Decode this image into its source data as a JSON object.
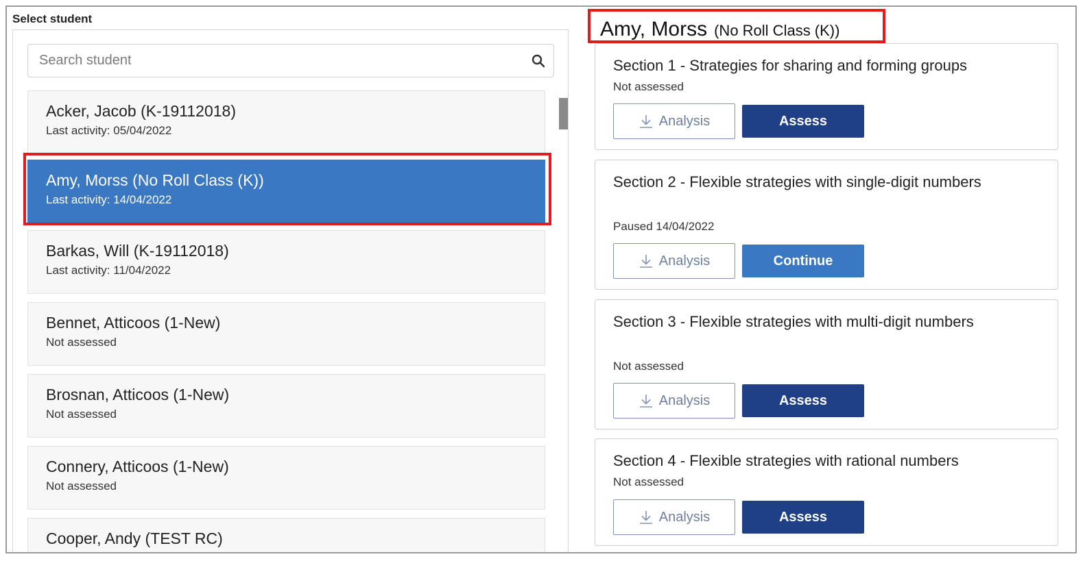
{
  "left_panel": {
    "label": "Select student",
    "search": {
      "placeholder": "Search student",
      "value": ""
    },
    "students": [
      {
        "name": "Acker, Jacob (K-19112018)",
        "sub": "Last activity: 05/04/2022",
        "selected": false
      },
      {
        "name": "Amy, Morss (No Roll Class (K))",
        "sub": "Last activity: 14/04/2022",
        "selected": true
      },
      {
        "name": "Barkas, Will (K-19112018)",
        "sub": "Last activity: 11/04/2022",
        "selected": false
      },
      {
        "name": "Bennet, Atticoos (1-New)",
        "sub": "Not assessed",
        "selected": false
      },
      {
        "name": "Brosnan, Atticoos (1-New)",
        "sub": "Not assessed",
        "selected": false
      },
      {
        "name": "Connery, Atticoos (1-New)",
        "sub": "Not assessed",
        "selected": false
      },
      {
        "name": "Cooper, Andy (TEST RC)",
        "sub": "",
        "selected": false
      }
    ]
  },
  "right_panel": {
    "student_name": "Amy, Morss",
    "student_class": "(No Roll Class (K))",
    "sections": [
      {
        "title": "Section 1 - Strategies for sharing and forming groups",
        "status": "Not assessed",
        "analysis_label": "Analysis",
        "action_label": "Assess",
        "action_type": "assess"
      },
      {
        "title": "Section 2 - Flexible strategies with single-digit numbers",
        "status": "Paused 14/04/2022",
        "analysis_label": "Analysis",
        "action_label": "Continue",
        "action_type": "continue"
      },
      {
        "title": "Section 3 - Flexible strategies with multi-digit numbers",
        "status": "Not assessed",
        "analysis_label": "Analysis",
        "action_label": "Assess",
        "action_type": "assess"
      },
      {
        "title": "Section 4 - Flexible strategies with rational numbers",
        "status": "Not assessed",
        "analysis_label": "Analysis",
        "action_label": "Assess",
        "action_type": "assess"
      }
    ]
  },
  "colors": {
    "selected": "#3b78c3",
    "assess_button": "#1f3f86",
    "continue_button": "#3b78c3",
    "highlight": "#e01c1c"
  },
  "icons": {
    "search": "search-icon",
    "download": "download-icon"
  }
}
